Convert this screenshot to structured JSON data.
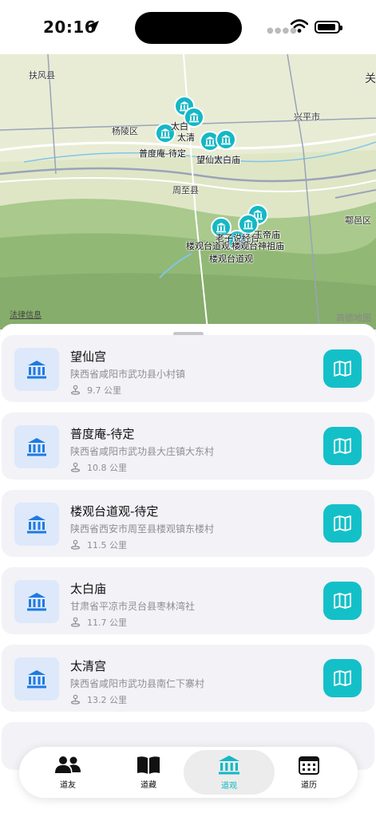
{
  "status_bar": {
    "time": "20:16"
  },
  "map": {
    "place_labels": [
      "扶风县",
      "杨陵区",
      "兴平市",
      "周至县",
      "鄠邑区",
      "关"
    ],
    "pin_labels": [
      "太白",
      "太清",
      "普度庵-待定",
      "望仙宫",
      "太白庙",
      "楼观台道观-待定",
      "楼观台道观",
      "老子说经台",
      "玉帝庙",
      "楼观台神祖庙"
    ],
    "legal": "法律信息",
    "provider": "高德地图"
  },
  "places": [
    {
      "name": "望仙宫",
      "address": "陕西省咸阳市武功县小村镇",
      "distance": "9.7 公里"
    },
    {
      "name": "普度庵-待定",
      "address": "陕西省咸阳市武功县大庄镇大东村",
      "distance": "10.8 公里"
    },
    {
      "name": "楼观台道观-待定",
      "address": "陕西省西安市周至县楼观镇东楼村",
      "distance": "11.5 公里"
    },
    {
      "name": "太白庙",
      "address": "甘肃省平凉市灵台县枣林湾社",
      "distance": "11.7 公里"
    },
    {
      "name": "太清宫",
      "address": "陕西省咸阳市武功县南仁下寨村",
      "distance": "13.2 公里"
    }
  ],
  "tabs": [
    {
      "label": "道友",
      "icon": "people-icon",
      "active": false
    },
    {
      "label": "道藏",
      "icon": "book-icon",
      "active": false
    },
    {
      "label": "道观",
      "icon": "temple-icon",
      "active": true
    },
    {
      "label": "道历",
      "icon": "calendar-icon",
      "active": false
    }
  ],
  "colors": {
    "accent": "#14b8c4",
    "thumb_bg": "#dde9fb",
    "card_bg": "#f2f2f7"
  }
}
